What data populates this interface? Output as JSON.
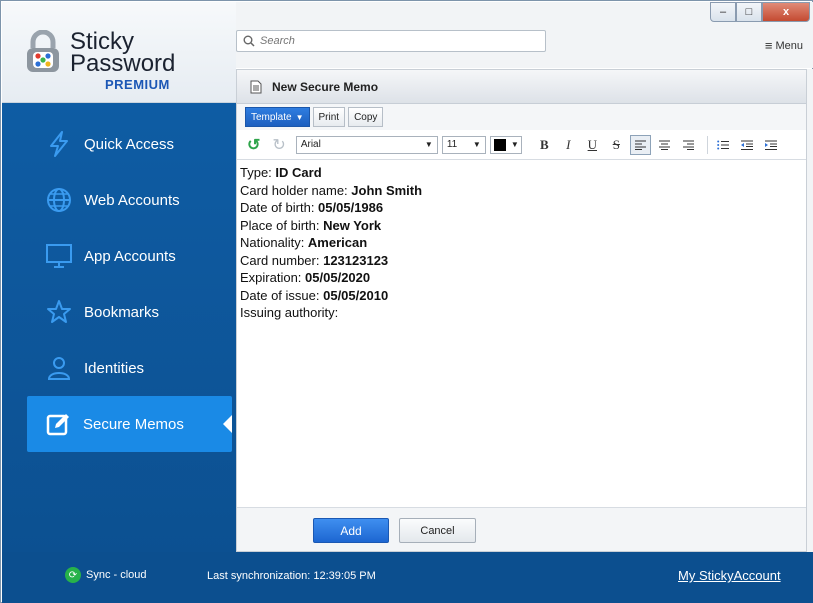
{
  "app": {
    "logo_line1": "Sticky",
    "logo_line2": "Password",
    "logo_edition": "PREMIUM"
  },
  "window_controls": {
    "minimize": "–",
    "maximize": "□",
    "close": "x"
  },
  "header": {
    "search_placeholder": "Search",
    "menu_label": "Menu"
  },
  "sidebar": {
    "items": [
      {
        "label": "Quick Access",
        "icon": "lightning-icon"
      },
      {
        "label": "Web Accounts",
        "icon": "globe-icon"
      },
      {
        "label": "App Accounts",
        "icon": "monitor-icon"
      },
      {
        "label": "Bookmarks",
        "icon": "star-icon"
      },
      {
        "label": "Identities",
        "icon": "person-icon"
      },
      {
        "label": "Secure Memos",
        "icon": "memo-edit-icon",
        "active": true
      }
    ]
  },
  "memo": {
    "title": "New Secure Memo",
    "toolbar": {
      "template": "Template",
      "print": "Print",
      "copy": "Copy",
      "font": "Arial",
      "size": "11",
      "text_color": "#000000"
    },
    "lines": [
      {
        "label": "Type: ",
        "value": "ID Card"
      },
      {
        "label": "Card holder name: ",
        "value": "John Smith"
      },
      {
        "label": "Date of birth: ",
        "value": "05/05/1986"
      },
      {
        "label": "Place of birth: ",
        "value": "New York"
      },
      {
        "label": "Nationality: ",
        "value": "American"
      },
      {
        "label": "Card number: ",
        "value": "123123123"
      },
      {
        "label": "Expiration: ",
        "value": "05/05/2020"
      },
      {
        "label": "Date of issue: ",
        "value": "05/05/2010"
      },
      {
        "label": "Issuing authority: ",
        "value": ""
      }
    ],
    "add_label": "Add",
    "cancel_label": "Cancel"
  },
  "footer": {
    "sync_status": "Sync - cloud",
    "last_sync": "Last synchronization: 12:39:05 PM",
    "account_link": "My StickyAccount"
  },
  "colors": {
    "sidebar_bg": "#0f5fa8",
    "active_item": "#1a8ae6",
    "accent_button": "#1d66d1",
    "sync_ok": "#27b24a"
  }
}
